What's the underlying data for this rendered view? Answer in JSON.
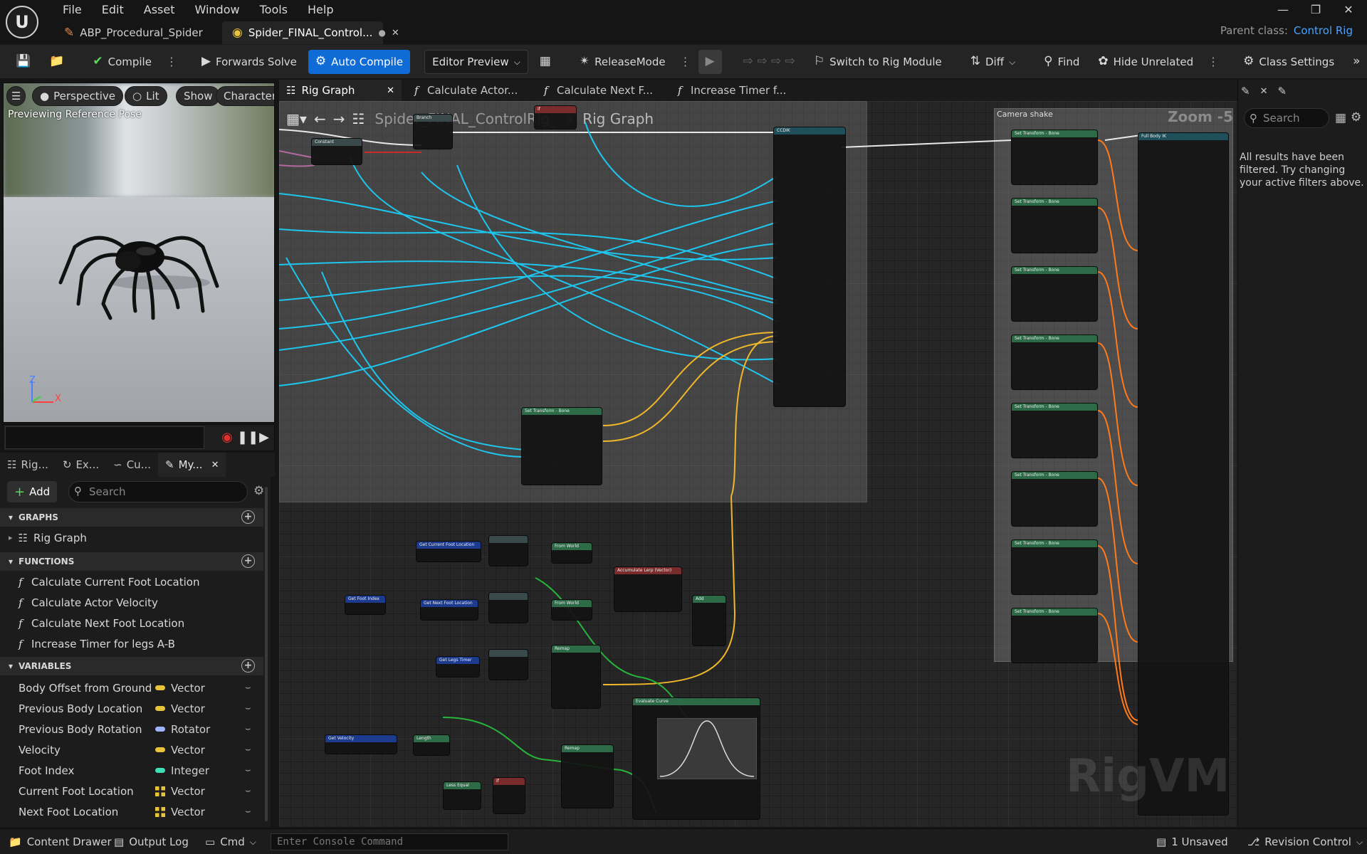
{
  "menu": [
    "File",
    "Edit",
    "Asset",
    "Window",
    "Tools",
    "Help"
  ],
  "document_tabs": [
    {
      "label": "ABP_Procedural_Spider",
      "active": false
    },
    {
      "label": "Spider_FINAL_Control...",
      "active": true
    }
  ],
  "parent_class": {
    "label": "Parent class:",
    "value": "Control Rig"
  },
  "toolbar": {
    "compile": "Compile",
    "forwards_solve": "Forwards Solve",
    "auto_compile": "Auto Compile",
    "editor_preview": "Editor Preview",
    "release_mode": "ReleaseMode",
    "switch_rig": "Switch to Rig Module",
    "diff": "Diff",
    "find": "Find",
    "hide_unrelated": "Hide Unrelated",
    "class_settings": "Class Settings"
  },
  "viewport": {
    "perspective": "Perspective",
    "lit": "Lit",
    "show": "Show",
    "character": "Character",
    "status": "Previewing Reference Pose",
    "axis_z": "Z",
    "axis_x": "X"
  },
  "left_tabs": [
    {
      "label": "Rig..."
    },
    {
      "label": "Ex..."
    },
    {
      "label": "Cu..."
    },
    {
      "label": "My..."
    }
  ],
  "left_panel": {
    "add": "Add",
    "search_placeholder": "Search",
    "graphs_header": "GRAPHS",
    "graphs": [
      "Rig Graph"
    ],
    "functions_header": "FUNCTIONS",
    "functions": [
      "Calculate Current Foot Location",
      "Calculate Actor Velocity",
      "Calculate Next Foot Location",
      "Increase Timer for legs A-B"
    ],
    "variables_header": "VARIABLES",
    "variables": [
      {
        "name": "Body Offset from Ground",
        "type": "Vector",
        "color": "#e8c43a",
        "array": false
      },
      {
        "name": "Previous Body Location",
        "type": "Vector",
        "color": "#e8c43a",
        "array": false
      },
      {
        "name": "Previous Body Rotation",
        "type": "Rotator",
        "color": "#9fb4ff",
        "array": false
      },
      {
        "name": "Velocity",
        "type": "Vector",
        "color": "#e8c43a",
        "array": false
      },
      {
        "name": "Foot Index",
        "type": "Integer",
        "color": "#3ee0b8",
        "array": false
      },
      {
        "name": "Current Foot Location",
        "type": "Vector",
        "color": "#e8c43a",
        "array": true
      },
      {
        "name": "Next Foot Location",
        "type": "Vector",
        "color": "#e8c43a",
        "array": true
      }
    ]
  },
  "graph_tabs": [
    {
      "label": "Rig Graph",
      "active": true
    },
    {
      "label": "Calculate Actor...",
      "active": false
    },
    {
      "label": "Calculate Next F...",
      "active": false
    },
    {
      "label": "Increase Timer f...",
      "active": false
    }
  ],
  "graph": {
    "breadcrumb_root": "Spider_FINAL_ControlRig_",
    "breadcrumb_leaf": "Rig Graph",
    "zoom": "Zoom -5",
    "comment_title": "Camera shake",
    "watermark": "RigVM",
    "nodes": {
      "set_transform": "Set Transform - Bone",
      "get_current_foot": "Get Current Foot Location",
      "get_next_foot": "Get Next Foot Location",
      "get_foot_index": "Get Foot Index",
      "get_legs_timer": "Get Legs Timer",
      "get_velocity": "Get Velocity",
      "from_world": "From World",
      "accumulate": "Accumulate Lerp (Vector)",
      "add": "Add",
      "remap": "Remap",
      "evaluate_curve": "Evaluate Curve",
      "length": "Length",
      "less_equal": "Less Equal",
      "if": "If",
      "constant": "Constant",
      "branch": "Branch",
      "ccdik": "CCDIK",
      "fabrik": "Full Body IK"
    }
  },
  "right_panel": {
    "search_placeholder": "Search",
    "message": "All results have been filtered. Try changing your active filters above."
  },
  "statusbar": {
    "content_drawer": "Content Drawer",
    "output_log": "Output Log",
    "cmd": "Cmd",
    "console_placeholder": "Enter Console Command",
    "unsaved": "1 Unsaved",
    "revision_control": "Revision Control"
  }
}
